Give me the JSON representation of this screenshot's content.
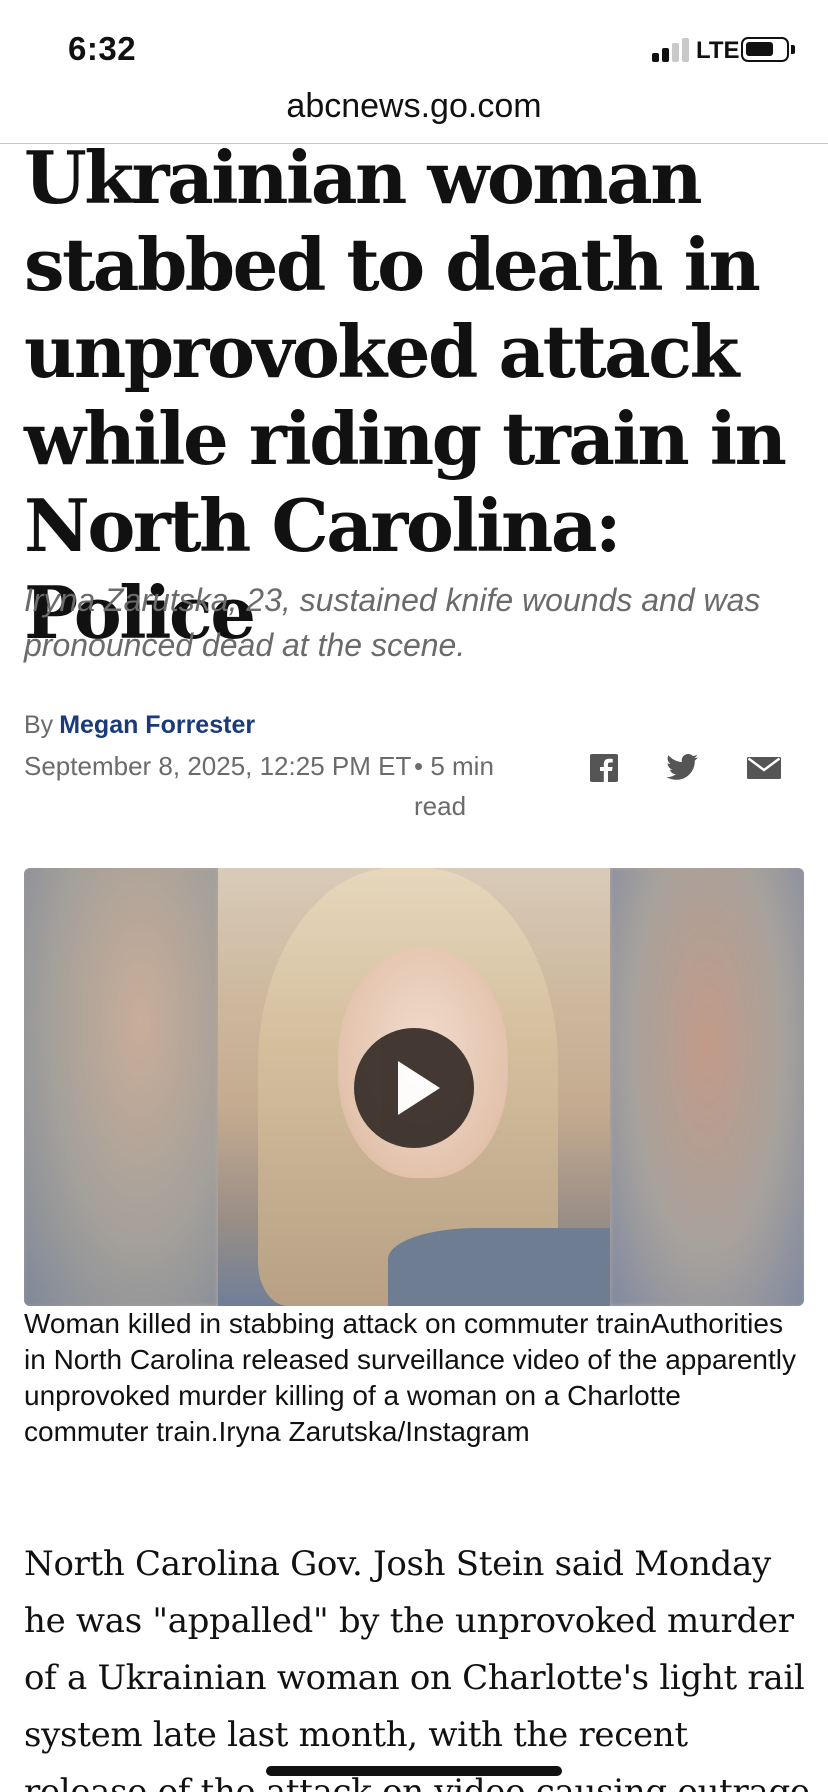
{
  "status_bar": {
    "time": "6:32",
    "network": "LTE",
    "signal_bars_active": 2,
    "signal_bars_total": 4
  },
  "browser": {
    "url": "abcnews.go.com"
  },
  "article": {
    "headline": "Ukrainian woman stabbed to death in unprovoked attack while riding train in North Carolina: Police",
    "subhead": "Iryna Zarutska, 23, sustained knife wounds and was pronounced dead at the scene.",
    "byline_prefix": "By",
    "author": "Megan Forrester",
    "date": "September 8, 2025, 12:25 PM ET",
    "read_time": "• 5 min read",
    "share_icons": [
      "facebook-icon",
      "twitter-icon",
      "mail-icon"
    ],
    "video_caption": "Woman killed in stabbing attack on commuter trainAuthorities in North Carolina released surveillance video of the apparently unprovoked murder killing of a woman on a Charlotte commuter train.Iryna Zarutska/Instagram",
    "body_paragraph": "North Carolina Gov. Josh Stein said Monday he was \"appalled\" by the unprovoked murder of a Ukrainian woman on Charlotte's light rail system late last month, with the recent release of the attack on video causing outrage"
  },
  "colors": {
    "author_link": "#1a3a7a",
    "meta_gray": "#6b6b6b",
    "icon_gray": "#555555"
  }
}
